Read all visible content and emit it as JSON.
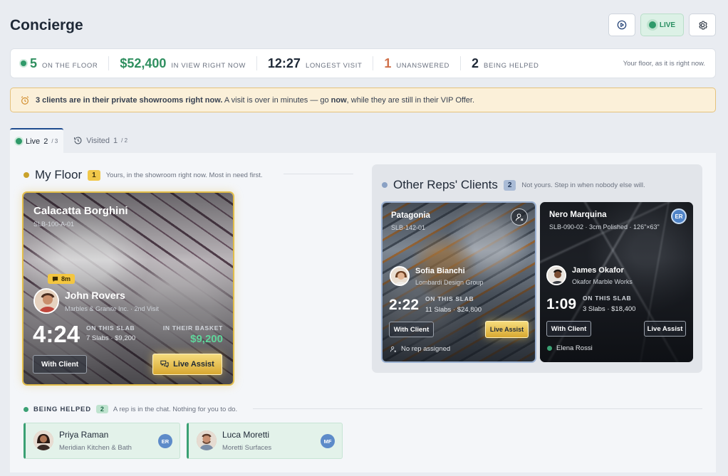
{
  "header": {
    "title": "Concierge",
    "live_label": "LIVE",
    "play_icon": "play-circle-icon",
    "settings_icon": "gear-icon"
  },
  "stats": {
    "on_floor": {
      "value": "5",
      "label": "ON THE FLOOR"
    },
    "in_view": {
      "value": "$52,400",
      "label": "IN VIEW RIGHT NOW"
    },
    "longest": {
      "value": "12:27",
      "label": "LONGEST VISIT"
    },
    "unanswered": {
      "value": "1",
      "label": "UNANSWERED"
    },
    "helped": {
      "value": "2",
      "label": "BEING HELPED"
    },
    "note": "Your floor, as it is right now.",
    "colors": {
      "green": "#2f8f5f",
      "orange": "#d0704a"
    }
  },
  "alert": {
    "bold_lead": "3 clients are in their private showrooms right now.",
    "text_1": " A visit is over in minutes — go ",
    "bold_now": "now",
    "text_2": ", while they are still in their VIP Offer.",
    "icon": "alarm-clock-icon"
  },
  "tabs": [
    {
      "label": "Live",
      "count": "2",
      "total": "/ 3"
    },
    {
      "label": "Visited",
      "count": "1",
      "total": "/ 2"
    }
  ],
  "my_floor": {
    "title": "My Floor",
    "count": "1",
    "desc": "Yours, in the showroom right now. Most in need first.",
    "card": {
      "slab_name": "Calacatta Borghini",
      "slab_id": "SLB-100-A-01",
      "chat_badge": "8m",
      "client_name": "John Rovers",
      "client_company": "Marbles & Granite Inc. · 2nd Visit",
      "time": "4:24",
      "on_slab_label": "ON THIS SLAB",
      "on_slab_value": "7 Slabs · $9,200",
      "basket_label": "IN THEIR BASKET",
      "basket_value": "$9,200",
      "with_client": "With Client",
      "live_assist": "Live Assist"
    }
  },
  "other_reps": {
    "title": "Other Reps' Clients",
    "count": "2",
    "desc": "Not yours. Step in when nobody else will.",
    "cards": [
      {
        "slab_name": "Patagonia",
        "slab_id": "SLB-142-01",
        "client_name": "Sofia Bianchi",
        "client_company": "Lombardi Design Group",
        "time": "2:22",
        "on_slab_label": "ON THIS SLAB",
        "on_slab_value": "11 Slabs · $24,800",
        "with_client": "With Client",
        "live_assist": "Live Assist",
        "footer": "No rep assigned",
        "corner_icon": "user-x-icon"
      },
      {
        "slab_name": "Nero Marquina",
        "slab_id": "SLB-090-02 · 3cm Polished · 126\"×63\"",
        "client_name": "James Okafor",
        "client_company": "Okafor Marble Works",
        "time": "1:09",
        "on_slab_label": "ON THIS SLAB",
        "on_slab_value": "3 Slabs · $18,400",
        "with_client": "With Client",
        "live_assist": "Live Assist",
        "footer": "Elena Rossi",
        "rep_initials": "ER"
      }
    ]
  },
  "being_helped": {
    "title": "BEING HELPED",
    "count": "2",
    "desc": "A rep is in the chat. Nothing for you to do.",
    "items": [
      {
        "name": "Priya Raman",
        "company": "Meridian Kitchen & Bath",
        "rep": "ER"
      },
      {
        "name": "Luca Moretti",
        "company": "Moretti Surfaces",
        "rep": "MF"
      }
    ]
  }
}
